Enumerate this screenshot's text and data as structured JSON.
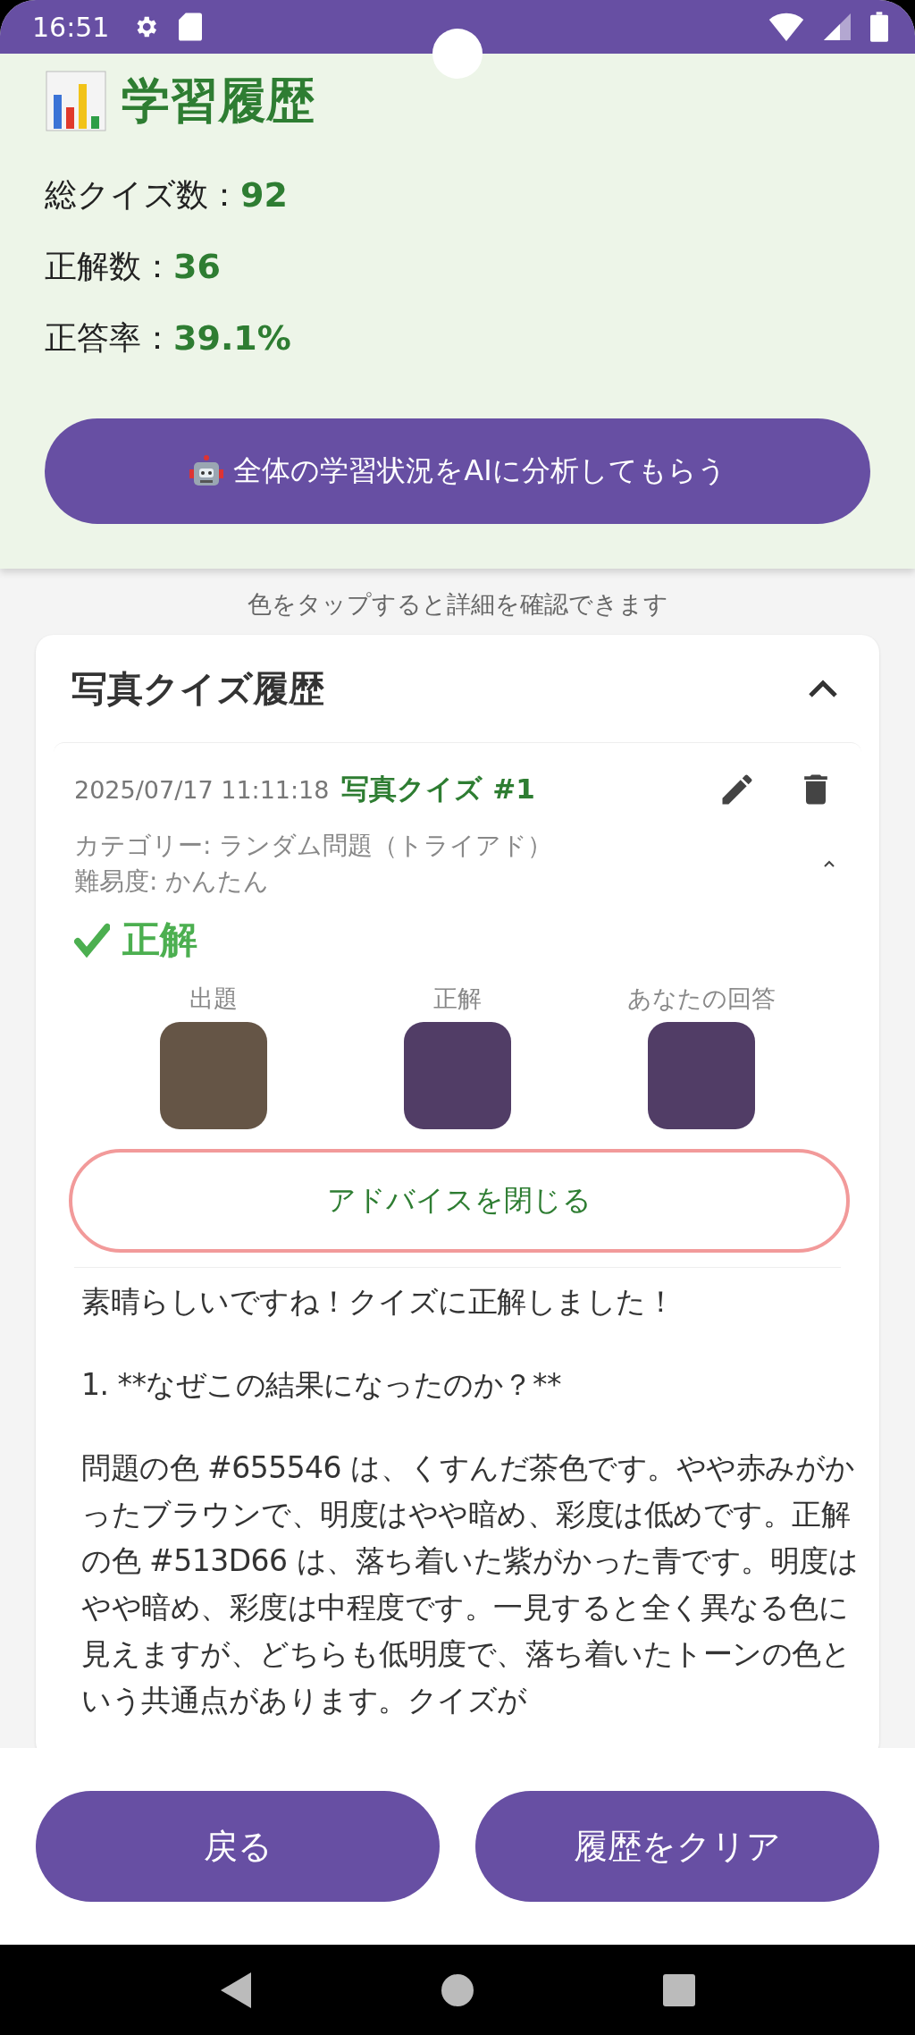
{
  "status_bar": {
    "time": "16:51"
  },
  "header": {
    "title": "学習履歴",
    "stats": [
      {
        "label": "総クイズ数：",
        "value": "92"
      },
      {
        "label": "正解数：",
        "value": "36"
      },
      {
        "label": "正答率：",
        "value": "39.1%"
      }
    ],
    "ai_button": "全体の学習状況をAIに分析してもらう"
  },
  "hint": "色をタップすると詳細を確認できます",
  "history": {
    "title": "写真クイズ履歴",
    "expanded": true,
    "items": [
      {
        "timestamp": "2025/07/17 11:11:18",
        "title": "写真クイズ #1",
        "category": "カテゴリー: ランダム問題（トライアド）",
        "difficulty": "難易度: かんたん",
        "expanded": true,
        "result": {
          "kind": "correct",
          "label": "正解"
        },
        "swatches": [
          {
            "label": "出題",
            "color": "#655546"
          },
          {
            "label": "正解",
            "color": "#513d66"
          },
          {
            "label": "あなたの回答",
            "color": "#513d66"
          }
        ],
        "advice_button": "アドバイスを閉じる",
        "advice": [
          "素晴らしいですね！クイズに正解しました！",
          "1. **なぜこの結果になったのか？**",
          "問題の色 #655546 は、くすんだ茶色です。やや赤みがかったブラウンで、明度はやや暗め、彩度は低めです。正解の色 #513D66 は、落ち着いた紫がかった青です。明度はやや暗め、彩度は中程度です。一見すると全く異なる色に見えますが、どちらも低明度で、落ち着いたトーンの色という共通点があります。クイズが"
        ]
      }
    ]
  },
  "bottom_buttons": [
    "戻る",
    "履歴をクリア"
  ]
}
